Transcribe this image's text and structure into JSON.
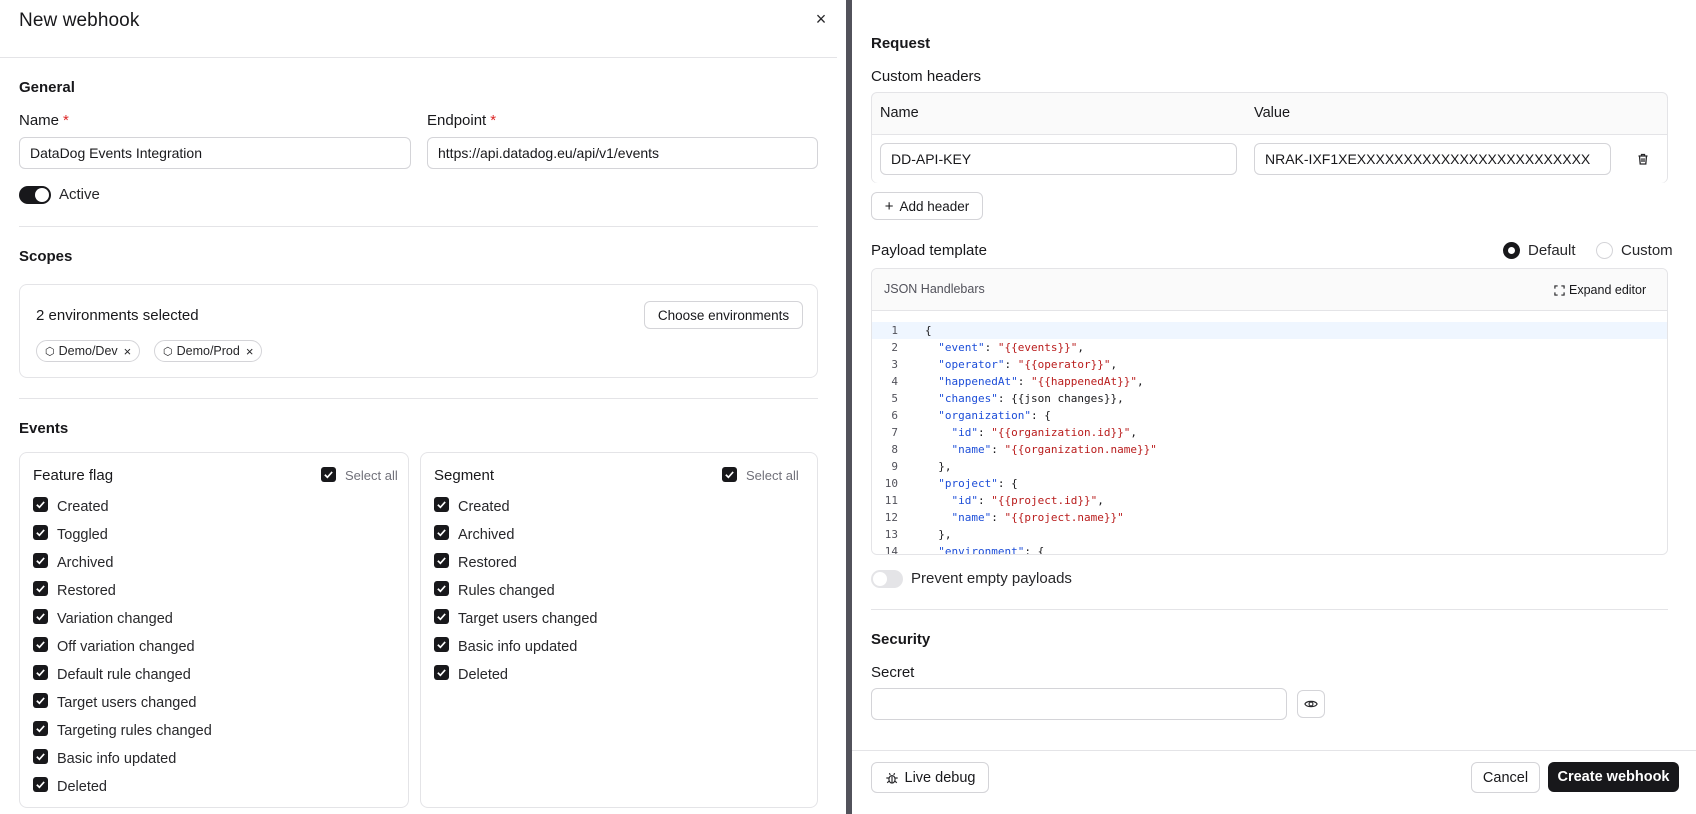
{
  "panel": {
    "title": "New webhook",
    "close_icon": "close-icon"
  },
  "general": {
    "section_title": "General",
    "name_label": "Name",
    "required_mark": "*",
    "name_value": "DataDog Events Integration",
    "endpoint_label": "Endpoint",
    "endpoint_value": "https://api.datadog.eu/api/v1/events",
    "active_label": "Active",
    "active": true
  },
  "scopes": {
    "section_title": "Scopes",
    "selected_text": "2 environments selected",
    "choose_button": "Choose environments",
    "chips": [
      {
        "label": "Demo/Dev",
        "icon": "cube-icon"
      },
      {
        "label": "Demo/Prod",
        "icon": "cube-icon"
      }
    ]
  },
  "events": {
    "section_title": "Events",
    "select_all_label": "Select all",
    "feature_flag": {
      "title": "Feature flag",
      "items": [
        "Created",
        "Toggled",
        "Archived",
        "Restored",
        "Variation changed",
        "Off variation changed",
        "Default rule changed",
        "Target users changed",
        "Targeting rules changed",
        "Basic info updated",
        "Deleted"
      ]
    },
    "segment": {
      "title": "Segment",
      "items": [
        "Created",
        "Archived",
        "Restored",
        "Rules changed",
        "Target users changed",
        "Basic info updated",
        "Deleted"
      ]
    }
  },
  "request": {
    "section_title": "Request",
    "custom_headers_label": "Custom headers",
    "col_name": "Name",
    "col_value": "Value",
    "header_name": "DD-API-KEY",
    "header_value": "NRAK-IXF1XEXXXXXXXXXXXXXXXXXXXXXXXXX",
    "add_header": "Add header",
    "payload_label": "Payload template",
    "radio_default": "Default",
    "radio_custom": "Custom",
    "selected_template": "Default",
    "editor_lang": "JSON Handlebars",
    "expand_editor": "Expand editor",
    "code_lines": [
      "{",
      "  \"event\": \"{{events}}\",",
      "  \"operator\": \"{{operator}}\",",
      "  \"happenedAt\": \"{{happenedAt}}\",",
      "  \"changes\": {{json changes}},",
      "  \"organization\": {",
      "    \"id\": \"{{organization.id}}\",",
      "    \"name\": \"{{organization.name}}\"",
      "  },",
      "  \"project\": {",
      "    \"id\": \"{{project.id}}\",",
      "    \"name\": \"{{project.name}}\"",
      "  },",
      "  \"environment\": {"
    ],
    "line_numbers": [
      "1",
      "2",
      "3",
      "4",
      "5",
      "6",
      "7",
      "8",
      "9",
      "10",
      "11",
      "12",
      "13",
      "14"
    ],
    "prevent_empty_label": "Prevent empty payloads",
    "prevent_empty": false
  },
  "security": {
    "section_title": "Security",
    "secret_label": "Secret",
    "secret_value": ""
  },
  "footer": {
    "live_debug": "Live debug",
    "cancel": "Cancel",
    "create": "Create webhook"
  },
  "colors": {
    "primary": "#18181b",
    "required": "#dc2626",
    "divider": "#52525b",
    "code_key": "#1d4ed8",
    "code_string": "#b91c1c"
  }
}
